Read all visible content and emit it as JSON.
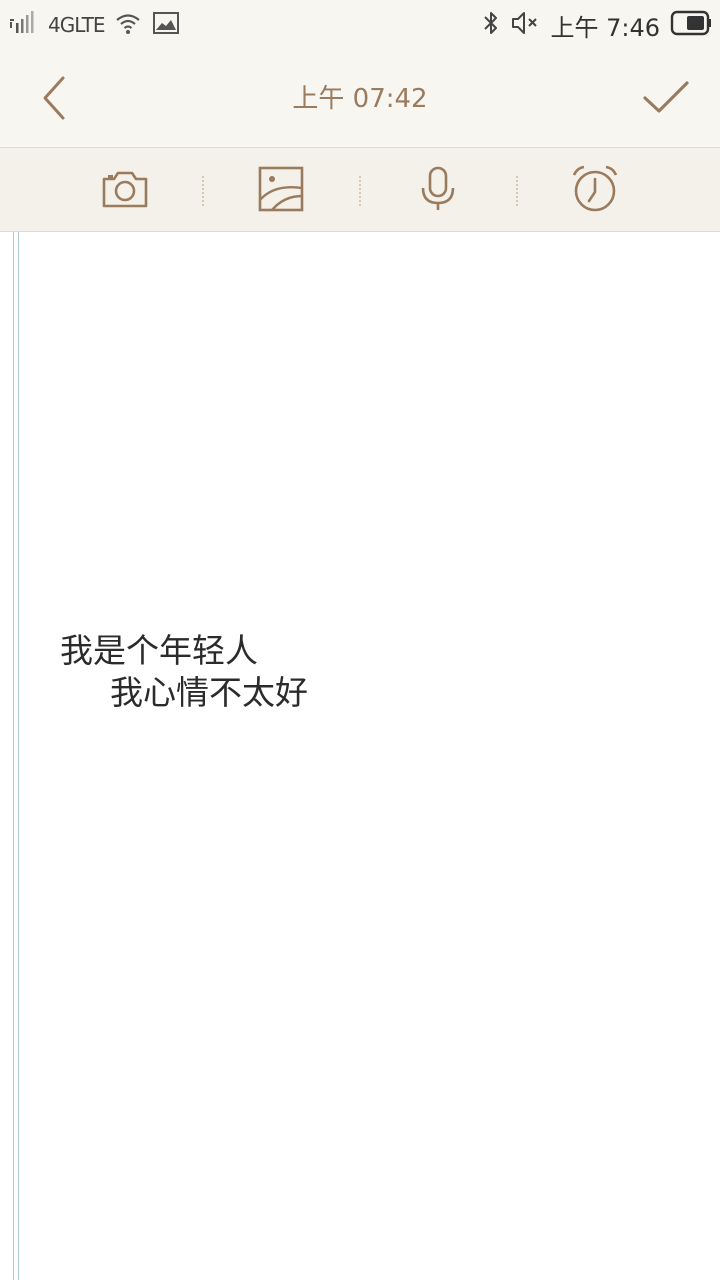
{
  "status_bar": {
    "network": "4GLTE",
    "time": "上午 7:46",
    "icons": [
      "signal-icon",
      "wifi-icon",
      "image-notification-icon",
      "bluetooth-icon",
      "mute-icon",
      "battery-icon"
    ]
  },
  "header": {
    "title": "上午 07:42",
    "back_icon": "chevron-left-icon",
    "confirm_icon": "checkmark-icon"
  },
  "toolbar": {
    "items": [
      "camera-icon",
      "image-icon",
      "microphone-icon",
      "alarm-clock-icon"
    ]
  },
  "note": {
    "lines": [
      "我是个年轻人",
      "我心情不太好"
    ]
  },
  "colors": {
    "accent": "#9b7b5e",
    "bar_background": "#f7f6f1",
    "toolbar_background": "#f3f1ea",
    "margin_red": "#e8b4b4",
    "margin_blue": "#a9c9d6",
    "text": "#2b2b2b"
  }
}
